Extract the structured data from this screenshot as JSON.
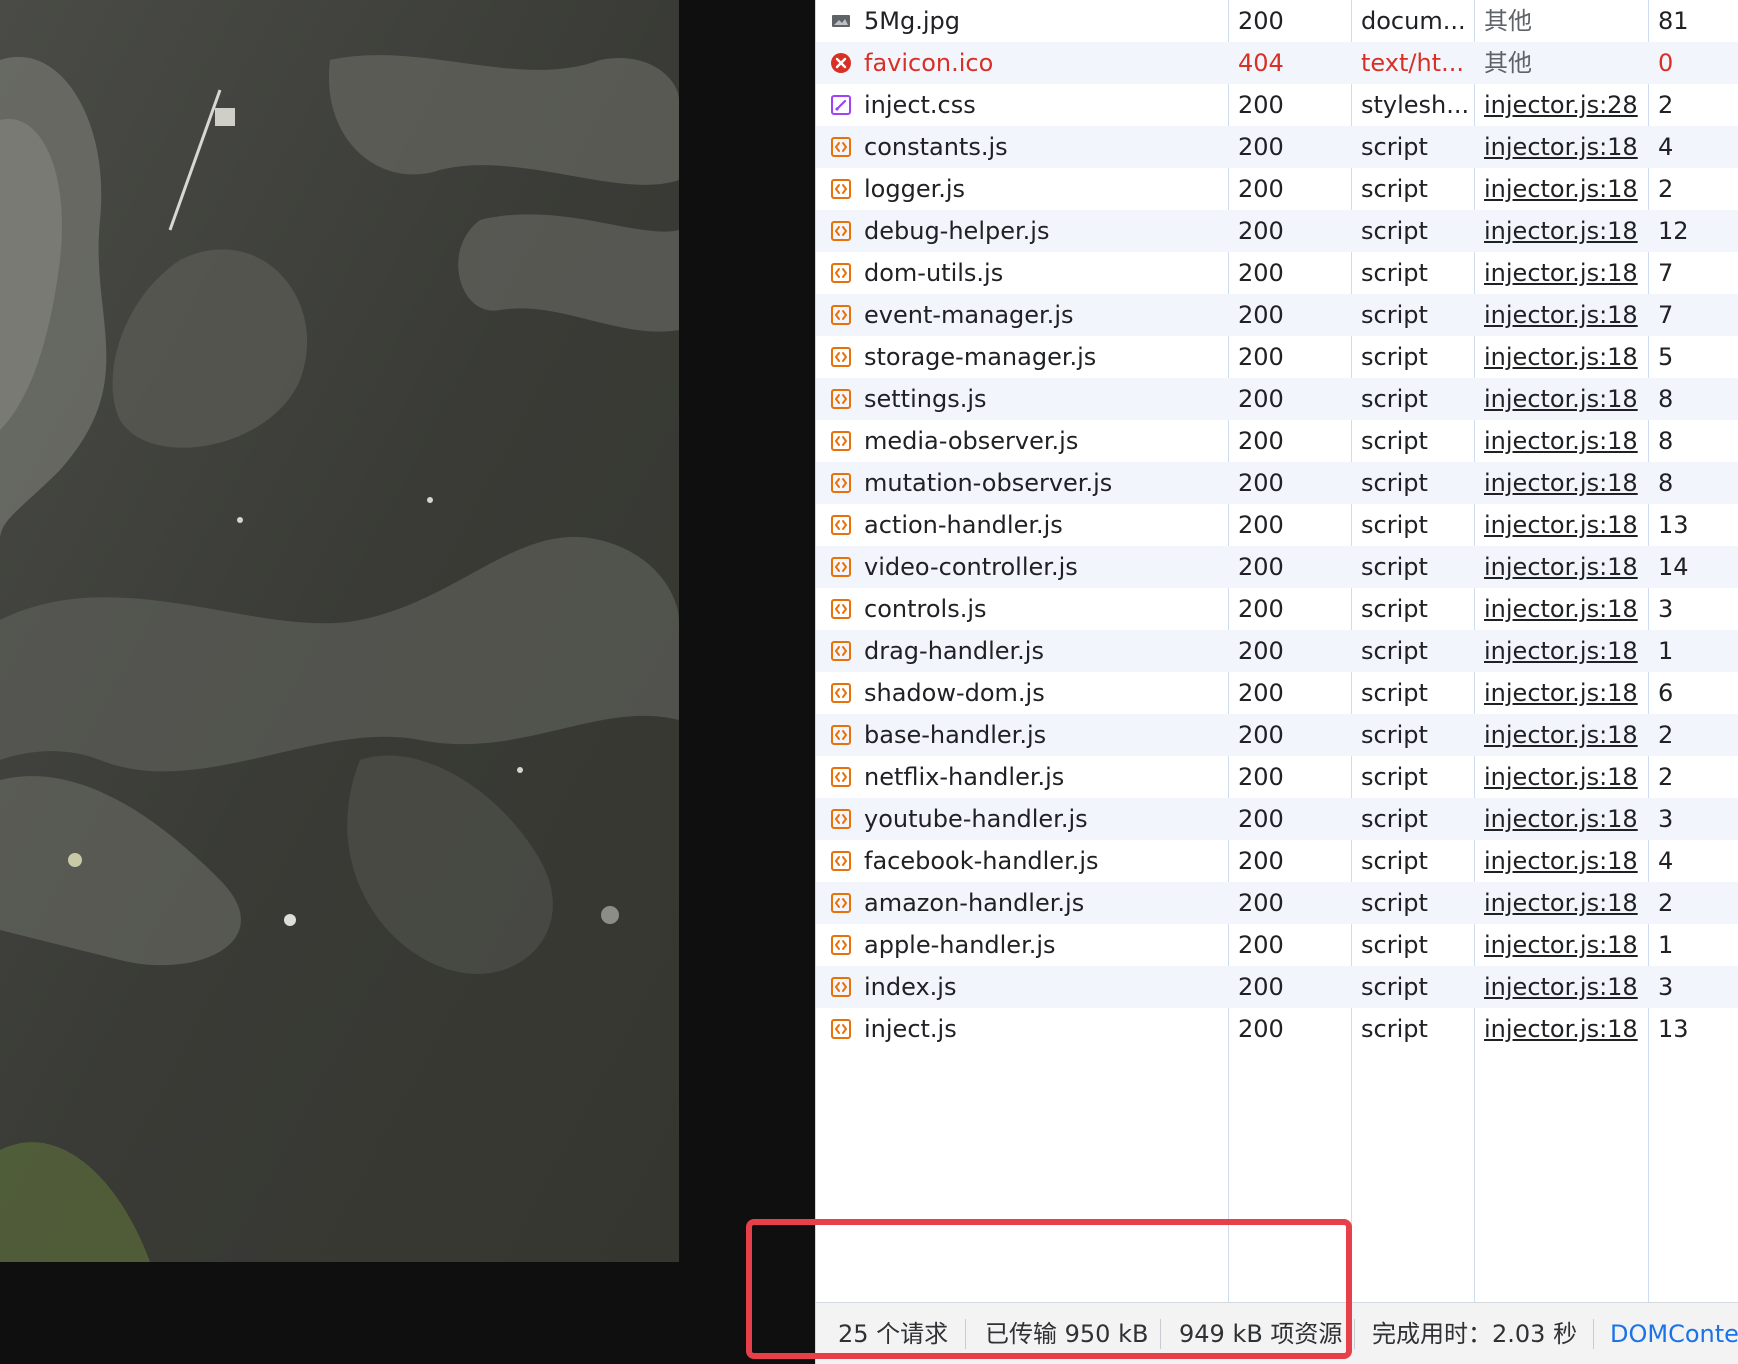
{
  "network": {
    "requests": [
      {
        "name": "5Mg.jpg",
        "status": "200",
        "type": "docum...",
        "initiator": "其他",
        "initiator_link": false,
        "size": "81",
        "icon": "image-icon",
        "error": false
      },
      {
        "name": "favicon.ico",
        "status": "404",
        "type": "text/ht...",
        "initiator": "其他",
        "initiator_link": false,
        "size": "0",
        "icon": "error-icon",
        "error": true
      },
      {
        "name": "inject.css",
        "status": "200",
        "type": "stylesh...",
        "initiator": "injector.js:28",
        "initiator_link": true,
        "size": "2",
        "icon": "stylesheet-icon",
        "error": false
      },
      {
        "name": "constants.js",
        "status": "200",
        "type": "script",
        "initiator": "injector.js:18",
        "initiator_link": true,
        "size": "4",
        "icon": "script-icon",
        "error": false
      },
      {
        "name": "logger.js",
        "status": "200",
        "type": "script",
        "initiator": "injector.js:18",
        "initiator_link": true,
        "size": "2",
        "icon": "script-icon",
        "error": false
      },
      {
        "name": "debug-helper.js",
        "status": "200",
        "type": "script",
        "initiator": "injector.js:18",
        "initiator_link": true,
        "size": "12",
        "icon": "script-icon",
        "error": false
      },
      {
        "name": "dom-utils.js",
        "status": "200",
        "type": "script",
        "initiator": "injector.js:18",
        "initiator_link": true,
        "size": "7",
        "icon": "script-icon",
        "error": false
      },
      {
        "name": "event-manager.js",
        "status": "200",
        "type": "script",
        "initiator": "injector.js:18",
        "initiator_link": true,
        "size": "7",
        "icon": "script-icon",
        "error": false
      },
      {
        "name": "storage-manager.js",
        "status": "200",
        "type": "script",
        "initiator": "injector.js:18",
        "initiator_link": true,
        "size": "5",
        "icon": "script-icon",
        "error": false
      },
      {
        "name": "settings.js",
        "status": "200",
        "type": "script",
        "initiator": "injector.js:18",
        "initiator_link": true,
        "size": "8",
        "icon": "script-icon",
        "error": false
      },
      {
        "name": "media-observer.js",
        "status": "200",
        "type": "script",
        "initiator": "injector.js:18",
        "initiator_link": true,
        "size": "8",
        "icon": "script-icon",
        "error": false
      },
      {
        "name": "mutation-observer.js",
        "status": "200",
        "type": "script",
        "initiator": "injector.js:18",
        "initiator_link": true,
        "size": "8",
        "icon": "script-icon",
        "error": false
      },
      {
        "name": "action-handler.js",
        "status": "200",
        "type": "script",
        "initiator": "injector.js:18",
        "initiator_link": true,
        "size": "13",
        "icon": "script-icon",
        "error": false
      },
      {
        "name": "video-controller.js",
        "status": "200",
        "type": "script",
        "initiator": "injector.js:18",
        "initiator_link": true,
        "size": "14",
        "icon": "script-icon",
        "error": false
      },
      {
        "name": "controls.js",
        "status": "200",
        "type": "script",
        "initiator": "injector.js:18",
        "initiator_link": true,
        "size": "3",
        "icon": "script-icon",
        "error": false
      },
      {
        "name": "drag-handler.js",
        "status": "200",
        "type": "script",
        "initiator": "injector.js:18",
        "initiator_link": true,
        "size": "1",
        "icon": "script-icon",
        "error": false
      },
      {
        "name": "shadow-dom.js",
        "status": "200",
        "type": "script",
        "initiator": "injector.js:18",
        "initiator_link": true,
        "size": "6",
        "icon": "script-icon",
        "error": false
      },
      {
        "name": "base-handler.js",
        "status": "200",
        "type": "script",
        "initiator": "injector.js:18",
        "initiator_link": true,
        "size": "2",
        "icon": "script-icon",
        "error": false
      },
      {
        "name": "netflix-handler.js",
        "status": "200",
        "type": "script",
        "initiator": "injector.js:18",
        "initiator_link": true,
        "size": "2",
        "icon": "script-icon",
        "error": false
      },
      {
        "name": "youtube-handler.js",
        "status": "200",
        "type": "script",
        "initiator": "injector.js:18",
        "initiator_link": true,
        "size": "3",
        "icon": "script-icon",
        "error": false
      },
      {
        "name": "facebook-handler.js",
        "status": "200",
        "type": "script",
        "initiator": "injector.js:18",
        "initiator_link": true,
        "size": "4",
        "icon": "script-icon",
        "error": false
      },
      {
        "name": "amazon-handler.js",
        "status": "200",
        "type": "script",
        "initiator": "injector.js:18",
        "initiator_link": true,
        "size": "2",
        "icon": "script-icon",
        "error": false
      },
      {
        "name": "apple-handler.js",
        "status": "200",
        "type": "script",
        "initiator": "injector.js:18",
        "initiator_link": true,
        "size": "1",
        "icon": "script-icon",
        "error": false
      },
      {
        "name": "index.js",
        "status": "200",
        "type": "script",
        "initiator": "injector.js:18",
        "initiator_link": true,
        "size": "3",
        "icon": "script-icon",
        "error": false
      },
      {
        "name": "inject.js",
        "status": "200",
        "type": "script",
        "initiator": "injector.js:18",
        "initiator_link": true,
        "size": "13",
        "icon": "script-icon",
        "error": false
      }
    ]
  },
  "status_bar": {
    "requests": "25 个请求",
    "transferred": "已传输 950 kB",
    "resources": "949 kB 项资源",
    "finish": "完成用时：2.03 秒",
    "dom_content_loaded": "DOMConte"
  },
  "colors": {
    "error": "#d93025",
    "script_icon": "#e8710a",
    "stylesheet_icon": "#a142f4",
    "alt_row": "#f2f6fc",
    "link": "#1a73e8",
    "highlight": "#e8404a"
  }
}
